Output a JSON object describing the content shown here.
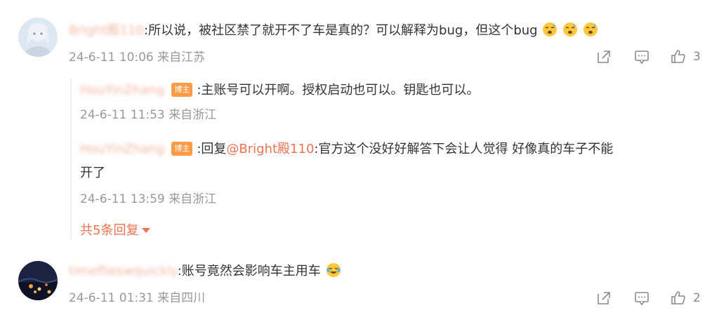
{
  "comments": [
    {
      "username": "Bright殿110",
      "text_prefix": ":所以说，被社区禁了就开不了车是真的？可以解释为bug，但这个bug",
      "meta": "24-6-11 10:06 来自江苏",
      "likes": "3",
      "emoji": "sweat-face-emoji"
    },
    {
      "username": "timeflieswquickly",
      "text_prefix": ":账号竟然会影响车主用车",
      "meta": "24-6-11 01:31 来自四川",
      "likes": "2",
      "emoji": "laughing-tears-emoji"
    }
  ],
  "replies": [
    {
      "username": "HouYinZhang",
      "badge": "博主",
      "text": ":主账号可以开啊。授权启动也可以。钥匙也可以。",
      "meta": "24-6-11 11:53 来自浙江"
    },
    {
      "username": "HouYinZhang",
      "badge": "博主",
      "reply_prefix": ":回复",
      "mention": "@Bright殿110",
      "text_line1": ":官方这个没好好解答下会让人觉得 好像真的车子不能",
      "text_line2": "开了",
      "meta": "24-6-11 13:59 来自浙江"
    }
  ],
  "more_replies": "共5条回复",
  "colors": {
    "link": "#eb7350",
    "meta": "#999999",
    "badge": "#ff9a46"
  }
}
